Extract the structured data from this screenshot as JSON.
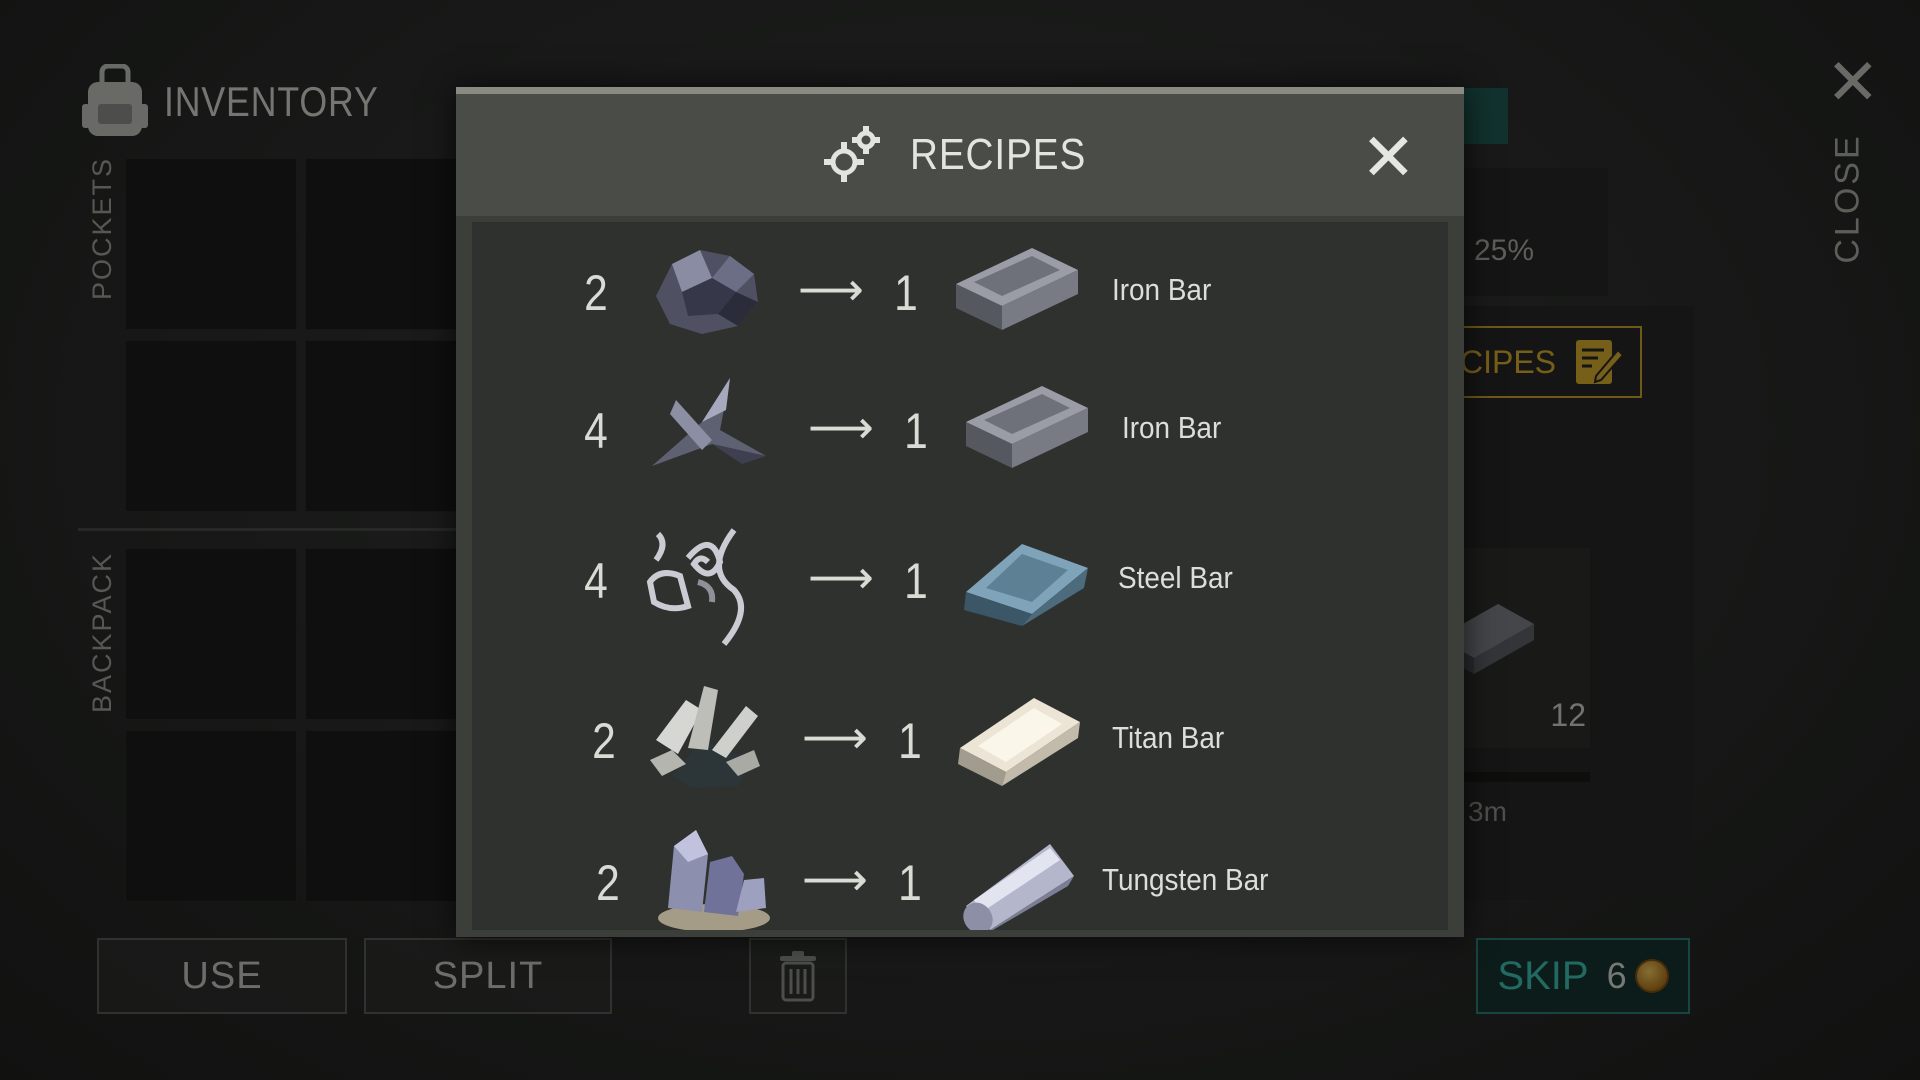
{
  "inventory": {
    "title": "INVENTORY",
    "pockets_label": "POCKETS",
    "backpack_label": "BACKPACK",
    "use_button": "USE",
    "split_button": "SPLIT"
  },
  "crafting_panel": {
    "percent_text": "25%",
    "recipes_button": "ECIPES",
    "stack_count": "12",
    "time_text": "3m",
    "skip_label": "SKIP",
    "skip_cost": "6"
  },
  "close_panel": {
    "close_label": "CLOSE"
  },
  "modal": {
    "title": "RECIPES",
    "recipes": [
      {
        "input_qty": "2",
        "input_icon": "iron-ore-icon",
        "output_qty": "1",
        "output_icon": "iron-bar-icon",
        "name": "Iron Bar"
      },
      {
        "input_qty": "4",
        "input_icon": "scrap-metal-icon",
        "output_qty": "1",
        "output_icon": "iron-bar-icon",
        "name": "Iron Bar"
      },
      {
        "input_qty": "4",
        "input_icon": "steel-shavings-icon",
        "output_qty": "1",
        "output_icon": "steel-bar-icon",
        "name": "Steel Bar"
      },
      {
        "input_qty": "2",
        "input_icon": "titan-crystal-icon",
        "output_qty": "1",
        "output_icon": "titan-bar-icon",
        "name": "Titan Bar"
      },
      {
        "input_qty": "2",
        "input_icon": "tungsten-ore-icon",
        "output_qty": "1",
        "output_icon": "tungsten-bar-icon",
        "name": "Tungsten Bar"
      }
    ]
  },
  "colors": {
    "accent_gold": "#d7ae2c",
    "accent_teal": "#3fc2b1"
  }
}
